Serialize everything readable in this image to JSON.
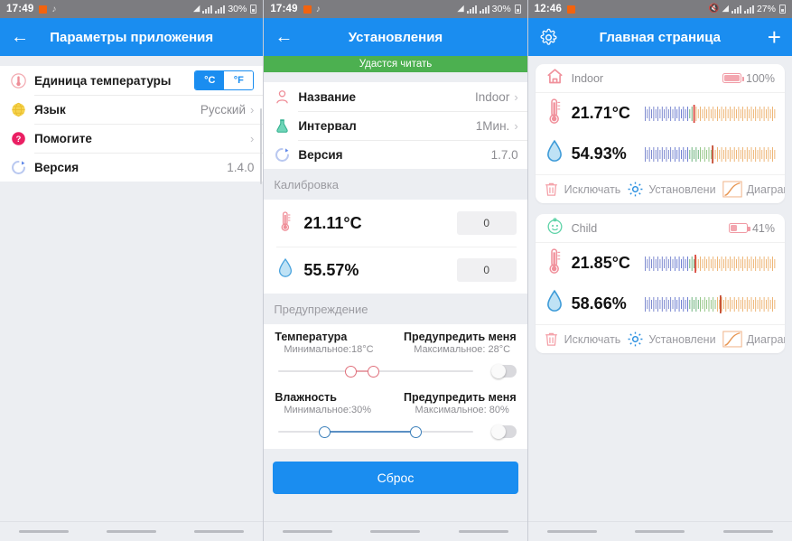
{
  "screens": [
    {
      "id": "app-settings",
      "statusbar": {
        "time": "17:49",
        "battery": "30%",
        "icons": [
          "orange-square-icon",
          "music-note-icon",
          "wifi-icon",
          "signal-icon",
          "signal-icon",
          "battery-icon"
        ]
      },
      "appbar": {
        "back": "←",
        "title": "Параметры приложения"
      },
      "rows": [
        {
          "icon": "thermometer-icon",
          "label": "Единица температуры",
          "control": "segmented",
          "options": [
            "°C",
            "°F"
          ],
          "selected": "°C"
        },
        {
          "icon": "globe-icon",
          "label": "Язык",
          "value": "Русский",
          "chevron": "›"
        },
        {
          "icon": "question-icon",
          "label": "Помогите",
          "value": "",
          "chevron": "›"
        },
        {
          "icon": "refresh-icon",
          "label": "Версия",
          "value": "1.4.0",
          "chevron": ""
        }
      ]
    },
    {
      "id": "device-settings",
      "statusbar": {
        "time": "17:49",
        "battery": "30%"
      },
      "appbar": {
        "back": "←",
        "title": "Установления"
      },
      "status_banner": "Удастся читать",
      "rows": [
        {
          "icon": "person-icon",
          "label": "Название",
          "value": "Indoor",
          "chevron": "›"
        },
        {
          "icon": "flask-icon",
          "label": "Интервал",
          "value": "1Мин.",
          "chevron": "›"
        },
        {
          "icon": "refresh-icon",
          "label": "Версия",
          "value": "1.7.0",
          "chevron": ""
        }
      ],
      "calibration": {
        "header": "Калибровка",
        "items": [
          {
            "icon": "thermometer-icon",
            "reading": "21.11°C",
            "offset": "0"
          },
          {
            "icon": "droplet-icon",
            "reading": "55.57%",
            "offset": "0"
          }
        ]
      },
      "alerts": {
        "header": "Предупреждение",
        "items": [
          {
            "name": "Температура",
            "notify": "Предупредить меня",
            "min": "Минимальное:18°C",
            "max": "Максимальное: 28°C",
            "min_pct": 37,
            "max_pct": 48,
            "enabled": false
          },
          {
            "name": "Влажность",
            "notify": "Предупредить меня",
            "min": "Минимальное:30%",
            "max": "Максимальное: 80%",
            "min_pct": 30,
            "max_pct": 80,
            "enabled": false
          }
        ]
      },
      "reset_label": "Сброс"
    },
    {
      "id": "home",
      "statusbar": {
        "time": "12:46",
        "battery": "27%"
      },
      "appbar": {
        "gear": "gear-icon",
        "title": "Главная страница",
        "plus": "+"
      },
      "actions": {
        "delete": "Исключать",
        "settings": "Установлени",
        "chart": "Диаграмма"
      },
      "sensors": [
        {
          "icon": "home-icon",
          "name": "Indoor",
          "battery": "100%",
          "battery_pct": 100,
          "temperature": "21.71°C",
          "temp_marker_pct": 38,
          "humidity": "54.93%",
          "hum_marker_pct": 52
        },
        {
          "icon": "baby-icon",
          "name": "Child",
          "battery": "41%",
          "battery_pct": 41,
          "temperature": "21.85°C",
          "temp_marker_pct": 39,
          "humidity": "58.66%",
          "hum_marker_pct": 58
        }
      ]
    }
  ],
  "colors": {
    "accent": "#1a8df0",
    "statusbar": "#7c7c80",
    "banner_green": "#4cb050",
    "page_bg": "#eceef2",
    "red": "#e8737f",
    "blue": "#3b7fba"
  }
}
